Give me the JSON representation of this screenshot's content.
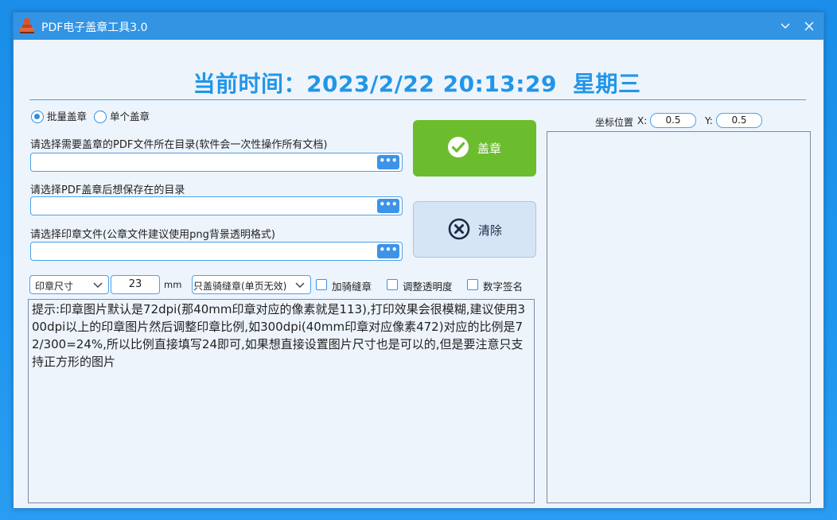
{
  "window": {
    "title": "PDF电子盖章工具3.0",
    "icons": {
      "app": "stamp-icon",
      "minimize": "chevron-down-icon",
      "close": "close-icon"
    }
  },
  "clock": {
    "label": "当前时间：",
    "date_time": "2023/2/22 20:13:29",
    "weekday": "星期三"
  },
  "mode": {
    "options": [
      {
        "label": "批量盖章",
        "selected": true
      },
      {
        "label": "单个盖章",
        "selected": false
      }
    ]
  },
  "fields": {
    "source_dir_label": "请选择需要盖章的PDF文件所在目录(软件会一次性操作所有文档)",
    "source_dir_value": "",
    "output_dir_label": "请选择PDF盖章后想保存在的目录",
    "output_dir_value": "",
    "seal_file_label": "请选择印章文件(公章文件建议使用png背景透明格式)",
    "seal_file_value": "",
    "browse_label": "•••"
  },
  "actions": {
    "stamp_label": "盖章",
    "clear_label": "清除"
  },
  "coords": {
    "label": "坐标位置",
    "x_label": "X:",
    "x_value": "0.5",
    "y_label": "Y:",
    "y_value": "0.5"
  },
  "options": {
    "size_mode": "印章尺寸",
    "size_value": "23",
    "size_unit": "mm",
    "seam_mode": "只盖骑缝章(单页无效)",
    "checkboxes": [
      {
        "label": "加骑缝章",
        "checked": false
      },
      {
        "label": "调整透明度",
        "checked": false
      },
      {
        "label": "数字签名",
        "checked": false
      }
    ]
  },
  "notes": {
    "text": "提示:印章图片默认是72dpi(那40mm印章对应的像素就是113),打印效果会很模糊,建议使用300dpi以上的印章图片然后调整印章比例,如300dpi(40mm印章对应像素472)对应的比例是72/300=24%,所以比例直接填写24即可,如果想直接设置图片尺寸也是可以的,但是要注意只支持正方形的图片"
  },
  "colors": {
    "accent": "#2196e9",
    "titlebar": "#3394e4",
    "stamp_button": "#6cbd2e",
    "clear_button": "#d6e5f5"
  }
}
